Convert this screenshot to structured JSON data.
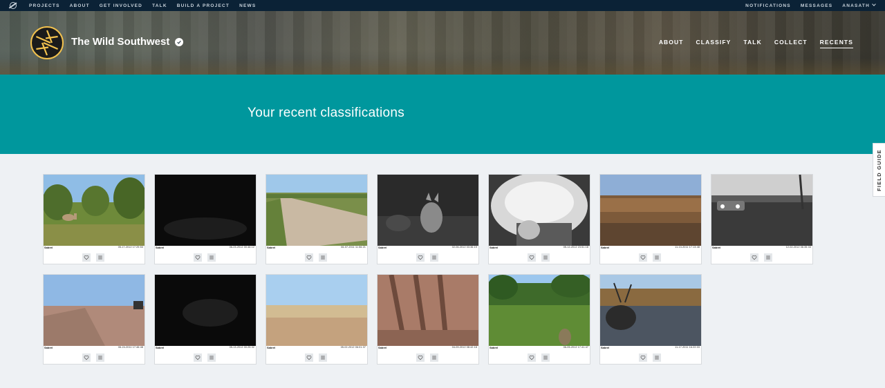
{
  "topbar": {
    "left_links": [
      "PROJECTS",
      "ABOUT",
      "GET INVOLVED",
      "TALK",
      "BUILD A PROJECT",
      "NEWS"
    ],
    "notifications": "NOTIFICATIONS",
    "messages": "MESSAGES",
    "user": "ANASATH"
  },
  "project": {
    "title": "The Wild Southwest",
    "nav": [
      "ABOUT",
      "CLASSIFY",
      "TALK",
      "COLLECT",
      "RECENTS"
    ],
    "active_nav": "RECENTS"
  },
  "banner": {
    "heading": "Your recent classifications"
  },
  "field_guide": "FIELD GUIDE",
  "subjects": [
    {
      "brand": "Sabrel",
      "datetime": "05-17-2012  17:29:53",
      "scene": "elk-grass"
    },
    {
      "brand": "Sabrel",
      "datetime": "06-23-2012  00:46:12",
      "scene": "night-dark"
    },
    {
      "brand": "Sabrel",
      "datetime": "06-07-2011  11:56:21",
      "scene": "dirt-road"
    },
    {
      "brand": "Sabrel",
      "datetime": "02-06-2012  03:36:19",
      "scene": "coyote-night"
    },
    {
      "brand": "Sabrel",
      "datetime": "05-12-2012  23:51:18",
      "scene": "closeup-night"
    },
    {
      "brand": "Sabrel",
      "datetime": "11-13-2011  17:13:48",
      "scene": "scrub-dusk"
    },
    {
      "brand": "Sabrel",
      "datetime": "12-02-2012  06:35:33",
      "scene": "truck-night"
    },
    {
      "brand": "Sabrel",
      "datetime": "06-24-2011  17:46:48",
      "scene": "tractor-field"
    },
    {
      "brand": "Sabrel",
      "datetime": "05-13-2012  00:25:32",
      "scene": "night-dark-2"
    },
    {
      "brand": "Sabrel",
      "datetime": "05-02-2012  06:01:37",
      "scene": "plain-bright"
    },
    {
      "brand": "Sabrel",
      "datetime": "04-09-2012  08:42:18",
      "scene": "shadows"
    },
    {
      "brand": "Sabrel",
      "datetime": "06-05-2012  17:41:47",
      "scene": "deer-meadow"
    },
    {
      "brand": "Sabrel",
      "datetime": "11-17-2011  16:22:03",
      "scene": "elk-river"
    }
  ],
  "icons": {
    "favorite": "heart-icon",
    "collect": "list-icon"
  },
  "colors": {
    "banner": "#00979d",
    "topbar": "#0b2236",
    "logo_ring": "#f2c14e",
    "page_bg": "#eef1f4"
  }
}
